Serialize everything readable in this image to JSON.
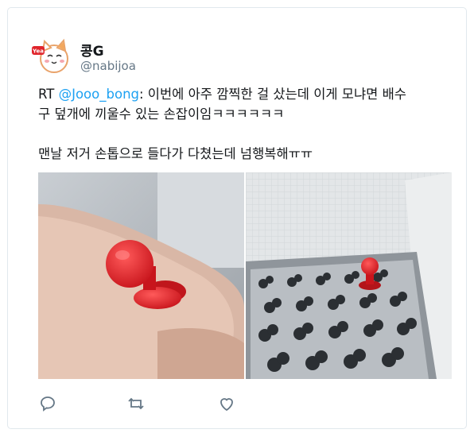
{
  "tweet": {
    "display_name": "콩G",
    "handle": "@nabijoa",
    "retweet_prefix": "RT ",
    "mention": "@Jooo_bong",
    "line1_rest": ": 이번에 아주 깜찍한 걸 샀는데 이게 모냐면 배수",
    "line2": "구 덮개에 끼울수 있는 손잡이임ㅋㅋㅋㅋㅋㅋ",
    "line3": "맨날 저거 손톱으로 들다가 다쳤는데 넘행복해ㅠㅠ",
    "avatar_badge_text": "Yea"
  },
  "colors": {
    "accent": "#1da1f2",
    "muted": "#657786",
    "knob_red": "#e0242b"
  },
  "icons": [
    "reply-icon",
    "retweet-icon",
    "like-icon"
  ]
}
